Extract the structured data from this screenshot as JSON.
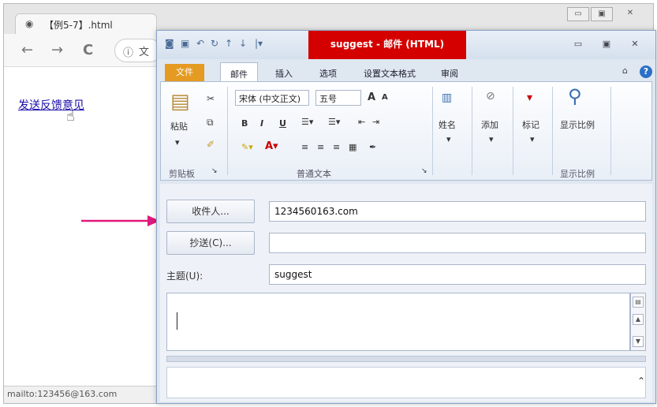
{
  "browser": {
    "tab_title": "【例5-7】.html",
    "omnibox_text": "文",
    "link_text": "发送反馈意见",
    "status_text": "mailto:123456@163.com"
  },
  "mail": {
    "window_title": "suggest - 邮件 (HTML)",
    "file_tab": "文件",
    "tabs": [
      "邮件",
      "插入",
      "选项",
      "设置文本格式",
      "审阅"
    ],
    "ribbon": {
      "paste_label": "粘贴",
      "clipboard_group": "剪贴板",
      "font_name": "宋体 (中文正文)",
      "font_size": "五号",
      "basic_text_group": "普通文本",
      "names_label": "姓名",
      "attach_label": "添加",
      "flag_label": "标记",
      "zoom_label": "显示比例",
      "zoom_group": "显示比例"
    },
    "to_button": "收件人...",
    "cc_button": "抄送(C)...",
    "subject_label": "主题(U):",
    "to_value": "1234560163.com",
    "cc_value": "",
    "subject_value": "suggest"
  }
}
